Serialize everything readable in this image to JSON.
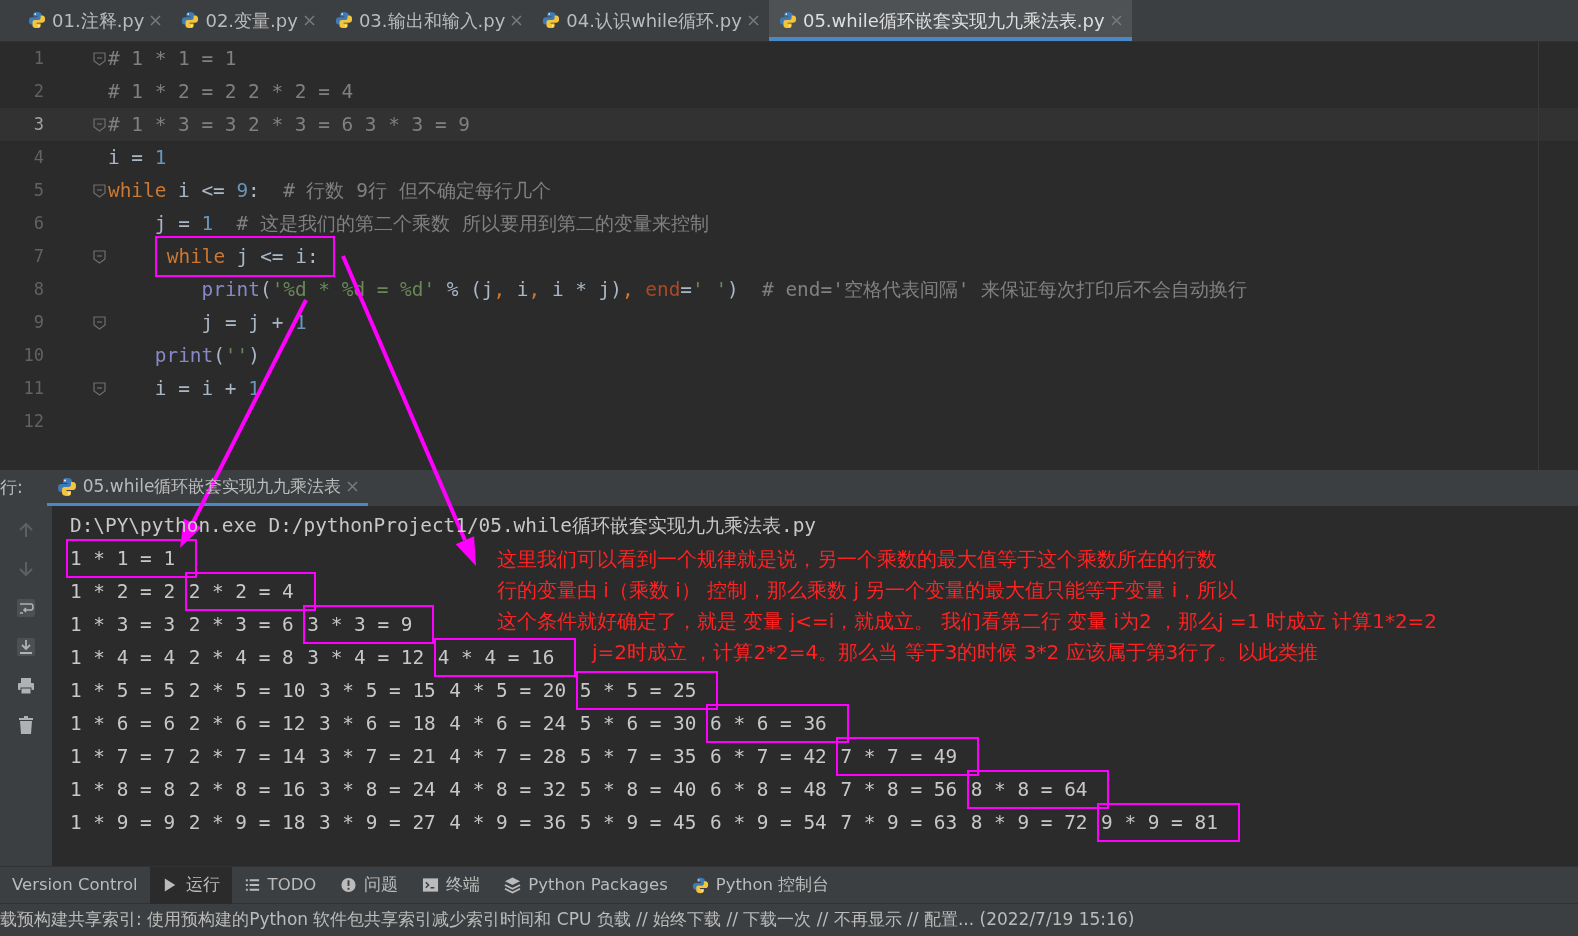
{
  "tabs": [
    {
      "label": "01.注释.py",
      "selected": false
    },
    {
      "label": "02.变量.py",
      "selected": false
    },
    {
      "label": "03.输出和输入.py",
      "selected": false
    },
    {
      "label": "04.认识while循环.py",
      "selected": false
    },
    {
      "label": "05.while循环嵌套实现九九乘法表.py",
      "selected": true
    }
  ],
  "editor": {
    "lines": [
      {
        "number": "1",
        "kind": "top",
        "current": false,
        "fold": true,
        "boxed": false,
        "tokens": [
          {
            "kind": "comment",
            "text": "# 1 * 1 = 1"
          }
        ]
      },
      {
        "number": "2",
        "kind": "top",
        "current": false,
        "fold": false,
        "boxed": false,
        "tokens": [
          {
            "kind": "comment",
            "text": "# 1 * 2 = 2 2 * 2 = 4"
          }
        ]
      },
      {
        "number": "3",
        "kind": "top",
        "current": true,
        "fold": true,
        "boxed": false,
        "tokens": [
          {
            "kind": "comment",
            "text": "# 1 * 3 = 3 2 * 3 = 6 3 * 3 = 9"
          }
        ]
      },
      {
        "number": "4",
        "kind": "top",
        "current": false,
        "fold": false,
        "boxed": false,
        "tokens": [
          {
            "kind": "plain",
            "text": "i = "
          },
          {
            "kind": "number",
            "text": "1"
          }
        ]
      },
      {
        "number": "5",
        "kind": "top",
        "current": false,
        "fold": true,
        "boxed": false,
        "tokens": [
          {
            "kind": "keyword",
            "text": "while"
          },
          {
            "kind": "plain",
            "text": " i <= "
          },
          {
            "kind": "number",
            "text": "9"
          },
          {
            "kind": "plain",
            "text": ":"
          },
          {
            "kind": "comment",
            "text": "# 行数 9行 但不确定每行几个"
          }
        ]
      },
      {
        "number": "6",
        "kind": "inner",
        "current": false,
        "fold": false,
        "boxed": false,
        "tokens": [
          {
            "kind": "plain",
            "text": "j = "
          },
          {
            "kind": "number",
            "text": "1"
          },
          {
            "kind": "comment",
            "text": "# 这是我们的第二个乘数 所以要用到第二的变量来控制"
          }
        ]
      },
      {
        "number": "7",
        "kind": "inner",
        "current": false,
        "fold": true,
        "boxed": true,
        "tokens": [
          {
            "kind": "keyword",
            "text": "while"
          },
          {
            "kind": "plain",
            "text": " j <= i:"
          }
        ]
      },
      {
        "number": "8",
        "kind": "innermost",
        "current": false,
        "fold": false,
        "boxed": false,
        "tokens": [
          {
            "kind": "builtin",
            "text": "print"
          },
          {
            "kind": "plain",
            "text": "("
          },
          {
            "kind": "string",
            "text": "'%d * %d = %d'"
          },
          {
            "kind": "plain",
            "text": " % (j"
          },
          {
            "kind": "keyword",
            "text": ","
          },
          {
            "kind": "plain",
            "text": " i"
          },
          {
            "kind": "keyword",
            "text": ","
          },
          {
            "kind": "plain",
            "text": " i * j)"
          },
          {
            "kind": "keyword",
            "text": ", "
          },
          {
            "kind": "param",
            "text": "end"
          },
          {
            "kind": "plain",
            "text": "="
          },
          {
            "kind": "string",
            "text": "' '"
          },
          {
            "kind": "plain",
            "text": ")"
          },
          {
            "kind": "comment",
            "text": "# end='空格代表间隔' 来保证每次打印后不会自动换行"
          }
        ]
      },
      {
        "number": "9",
        "kind": "innermost",
        "current": false,
        "fold": true,
        "boxed": false,
        "tokens": [
          {
            "kind": "plain",
            "text": "j = j + "
          },
          {
            "kind": "number",
            "text": "1"
          }
        ]
      },
      {
        "number": "10",
        "kind": "inner",
        "current": false,
        "fold": false,
        "boxed": false,
        "tokens": [
          {
            "kind": "builtin",
            "text": "print"
          },
          {
            "kind": "plain",
            "text": "("
          },
          {
            "kind": "string",
            "text": "''"
          },
          {
            "kind": "plain",
            "text": ")"
          }
        ]
      },
      {
        "number": "11",
        "kind": "inner",
        "current": false,
        "fold": true,
        "boxed": false,
        "tokens": [
          {
            "kind": "plain",
            "text": "i = i + "
          },
          {
            "kind": "number",
            "text": "1"
          }
        ]
      },
      {
        "number": "12",
        "current": false,
        "fold": false,
        "boxed": false
      }
    ]
  },
  "run_panel": {
    "label": "行:",
    "tab": "05.while循环嵌套实现九九乘法表",
    "command": "D:\\PY\\python.exe D:/pythonProject1/05.while循环嵌套实现九九乘法表.py",
    "rows": [
      {
        "entries": [
          {
            "text": "1 * 1 = 1",
            "boxed": true
          }
        ]
      },
      {
        "entries": [
          {
            "text": "1 * 2 = 2",
            "boxed": false
          },
          {
            "text": "2 * 2 = 4",
            "boxed": true
          }
        ]
      },
      {
        "entries": [
          {
            "text": "1 * 3 = 3",
            "boxed": false
          },
          {
            "text": "2 * 3 = 6",
            "boxed": false
          },
          {
            "text": "3 * 3 = 9",
            "boxed": true
          }
        ]
      },
      {
        "entries": [
          {
            "text": "1 * 4 = 4",
            "boxed": false
          },
          {
            "text": "2 * 4 = 8",
            "boxed": false
          },
          {
            "text": "3 * 4 = 12",
            "boxed": false
          },
          {
            "text": "4 * 4 = 16",
            "boxed": true
          }
        ]
      },
      {
        "entries": [
          {
            "text": "1 * 5 = 5",
            "boxed": false
          },
          {
            "text": "2 * 5 = 10",
            "boxed": false
          },
          {
            "text": "3 * 5 = 15",
            "boxed": false
          },
          {
            "text": "4 * 5 = 20",
            "boxed": false
          },
          {
            "text": "5 * 5 = 25",
            "boxed": true
          }
        ]
      },
      {
        "entries": [
          {
            "text": "1 * 6 = 6",
            "boxed": false
          },
          {
            "text": "2 * 6 = 12",
            "boxed": false
          },
          {
            "text": "3 * 6 = 18",
            "boxed": false
          },
          {
            "text": "4 * 6 = 24",
            "boxed": false
          },
          {
            "text": "5 * 6 = 30",
            "boxed": false
          },
          {
            "text": "6 * 6 = 36",
            "boxed": true
          }
        ]
      },
      {
        "entries": [
          {
            "text": "1 * 7 = 7",
            "boxed": false
          },
          {
            "text": "2 * 7 = 14",
            "boxed": false
          },
          {
            "text": "3 * 7 = 21",
            "boxed": false
          },
          {
            "text": "4 * 7 = 28",
            "boxed": false
          },
          {
            "text": "5 * 7 = 35",
            "boxed": false
          },
          {
            "text": "6 * 7 = 42",
            "boxed": false
          },
          {
            "text": "7 * 7 = 49",
            "boxed": true
          }
        ]
      },
      {
        "entries": [
          {
            "text": "1 * 8 = 8",
            "boxed": false
          },
          {
            "text": "2 * 8 = 16",
            "boxed": false
          },
          {
            "text": "3 * 8 = 24",
            "boxed": false
          },
          {
            "text": "4 * 8 = 32",
            "boxed": false
          },
          {
            "text": "5 * 8 = 40",
            "boxed": false
          },
          {
            "text": "6 * 8 = 48",
            "boxed": false
          },
          {
            "text": "7 * 8 = 56",
            "boxed": false
          },
          {
            "text": "8 * 8 = 64",
            "boxed": true
          }
        ]
      },
      {
        "entries": [
          {
            "text": "1 * 9 = 9",
            "boxed": false
          },
          {
            "text": "2 * 9 = 18",
            "boxed": false
          },
          {
            "text": "3 * 9 = 27",
            "boxed": false
          },
          {
            "text": "4 * 9 = 36",
            "boxed": false
          },
          {
            "text": "5 * 9 = 45",
            "boxed": false
          },
          {
            "text": "6 * 9 = 54",
            "boxed": false
          },
          {
            "text": "7 * 9 = 63",
            "boxed": false
          },
          {
            "text": "8 * 9 = 72",
            "boxed": false
          },
          {
            "text": "9 * 9 = 81",
            "boxed": true
          }
        ]
      }
    ]
  },
  "annotation": [
    "这里我们可以看到一个规律就是说，另一个乘数的最大值等于这个乘数所在的行数",
    "行的变量由 i（乘数 i） 控制，那么乘数 j 另一个变量的最大值只能等于变量 i，所以",
    "这个条件就好确定了，就是 变量 j<=i，就成立。 我们看第二行 变量 i为2 ，那么j =1 时成立 计算1*2=2",
    "j=2时成立 ，计算2*2=4。那么当 等于3的时候 3*2 应该属于第3行了。以此类推"
  ],
  "tool_windows": [
    {
      "label": "Version Control",
      "selected": false
    },
    {
      "label": "运行",
      "selected": true
    },
    {
      "label": "TODO",
      "selected": false
    },
    {
      "label": "问题",
      "selected": false
    },
    {
      "label": "终端",
      "selected": false
    },
    {
      "label": "Python Packages",
      "selected": false
    },
    {
      "label": "Python 控制台",
      "selected": false
    }
  ],
  "status_bar": "载预构建共享索引: 使用预构建的Python 软件包共享索引减少索引时间和 CPU 负载 // 始终下载 // 下载一次 // 不再显示 // 配置... (2022/7/19 15:16)"
}
